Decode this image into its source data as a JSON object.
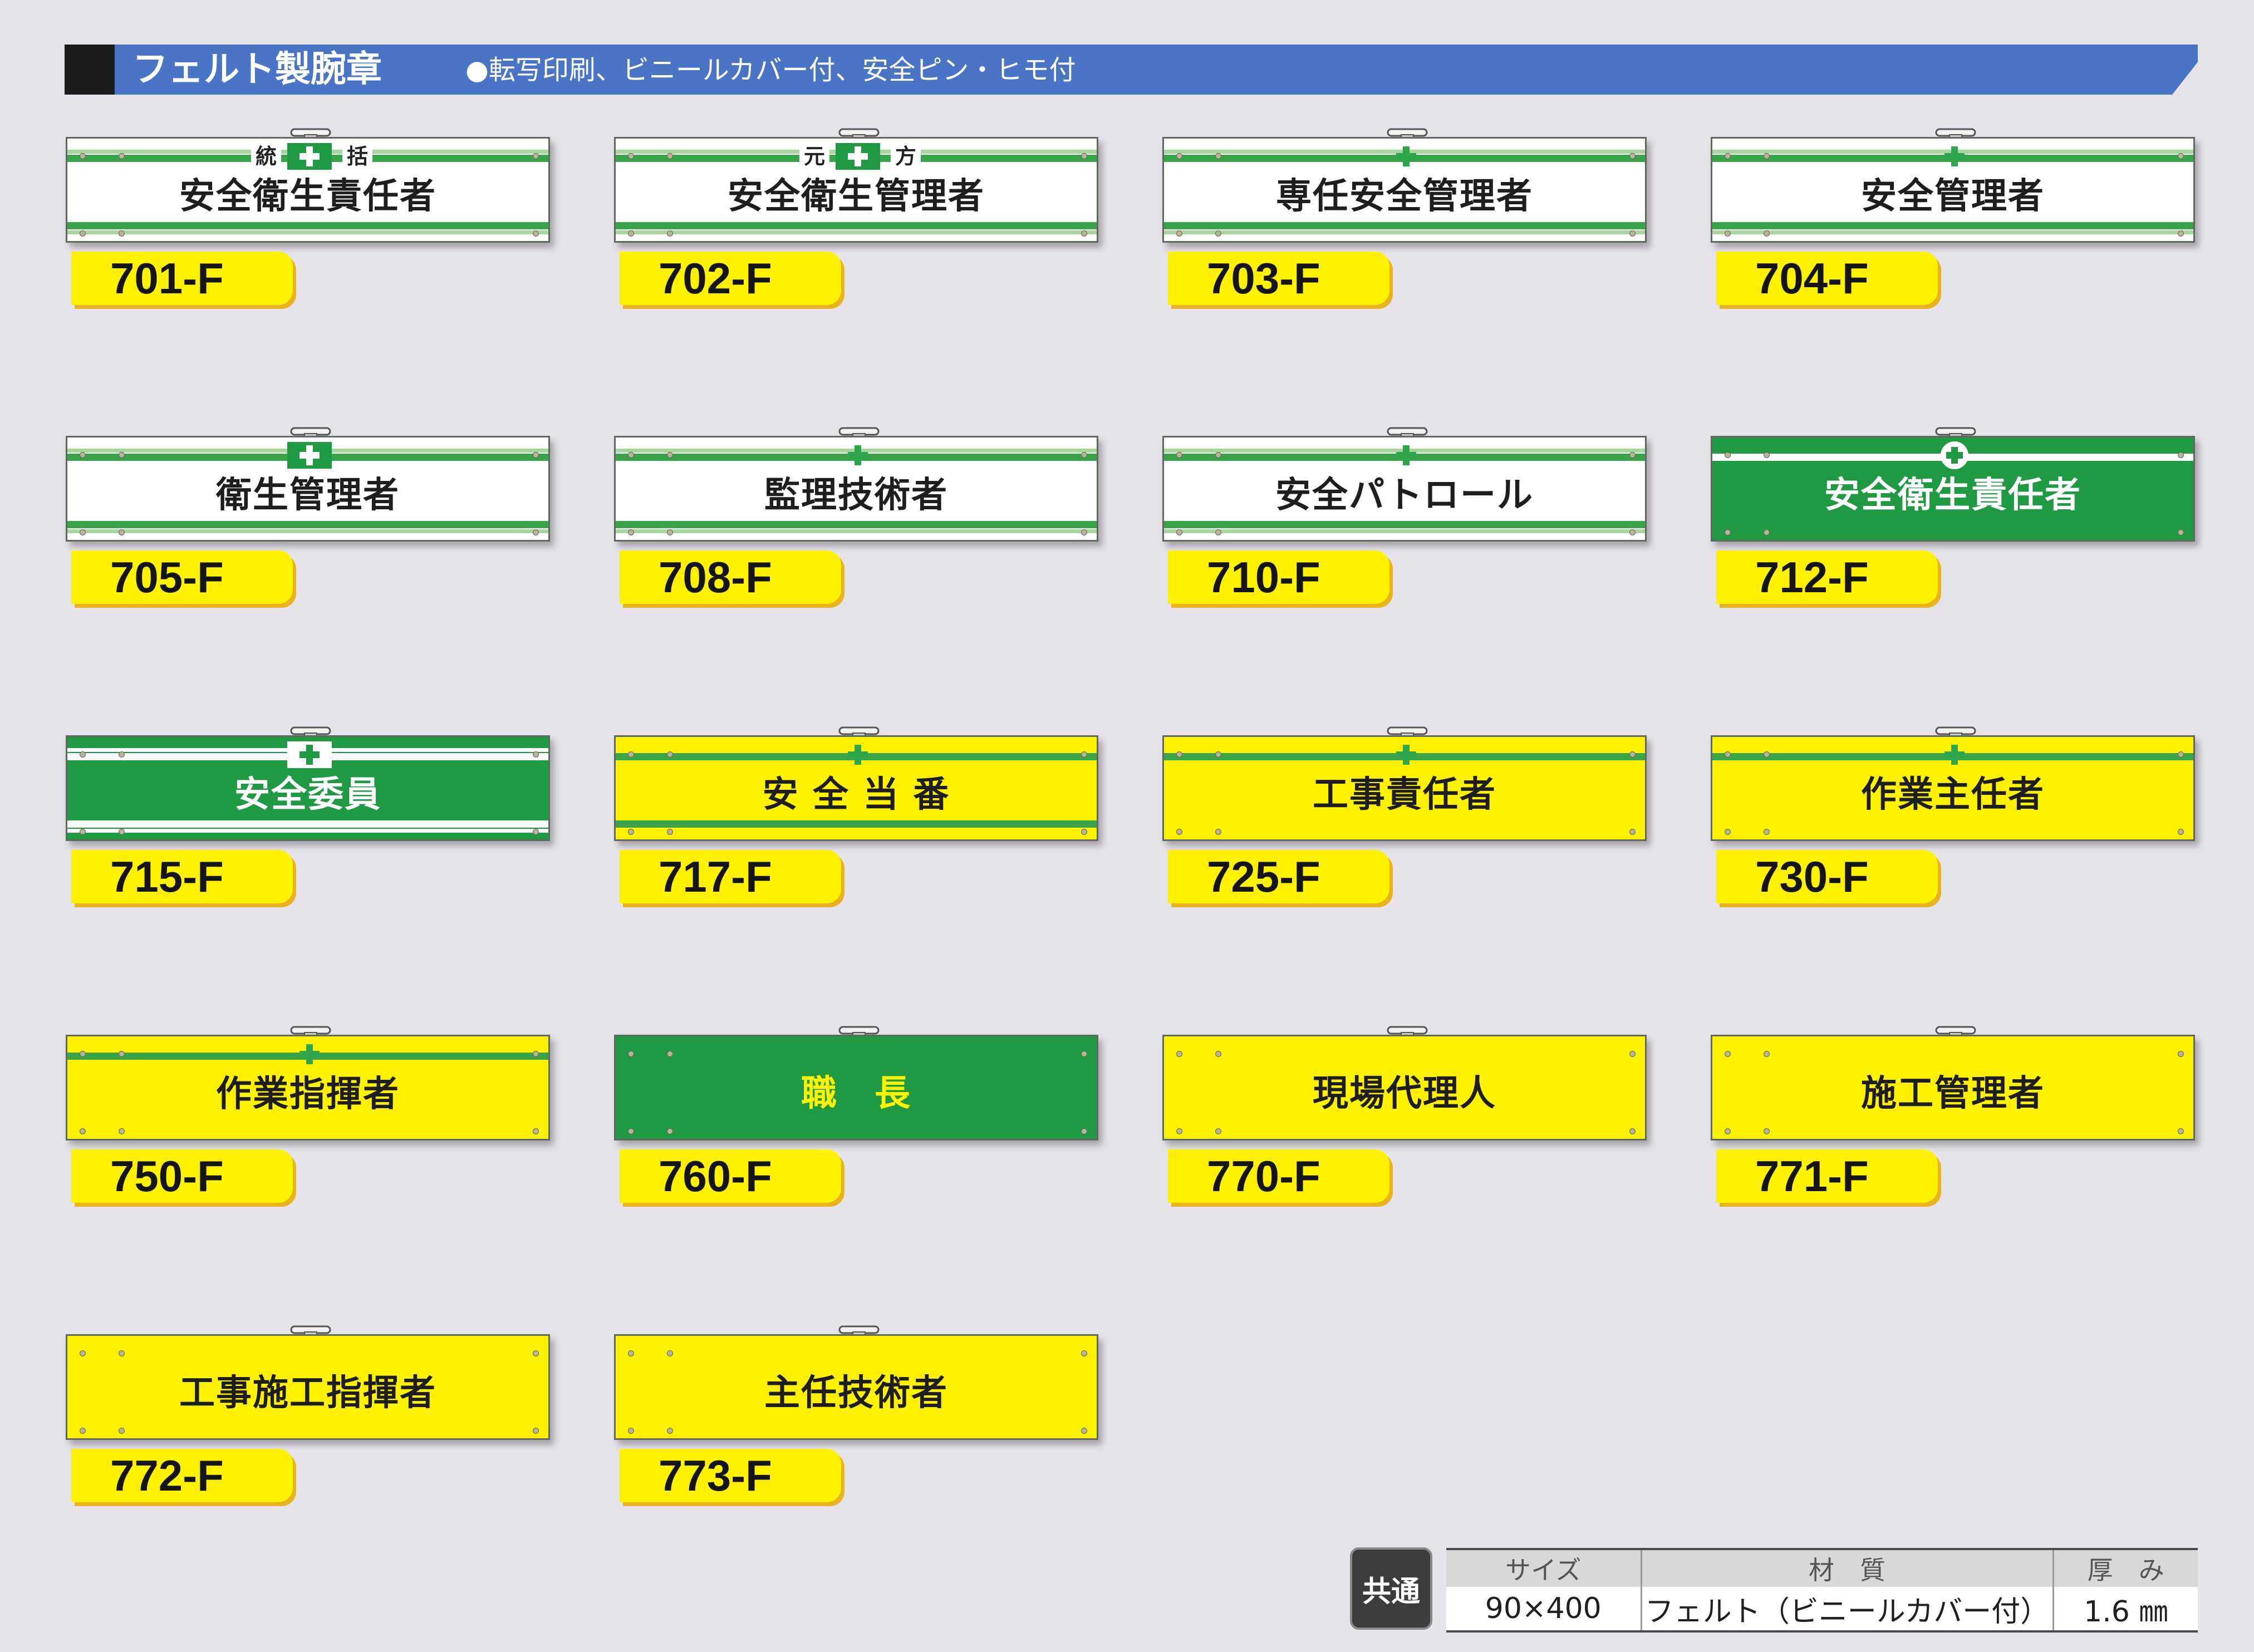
{
  "header": {
    "title": "フェルト製腕章",
    "subtitle": "●転写印刷、ビニールカバー付、安全ピン・ヒモ付"
  },
  "colors": {
    "header_blue": "#4a74c6",
    "band_green": "#1f9a43",
    "band_yellow": "#fff200",
    "tag_yellow": "#fff200",
    "stripe_green": "#3aa44a",
    "background": "#e6e3ea"
  },
  "products": [
    {
      "code": "701-F",
      "label": "安全衛生責任者",
      "band": "white",
      "badge": "box-cross",
      "left_label": "統",
      "right_label": "括"
    },
    {
      "code": "702-F",
      "label": "安全衛生管理者",
      "band": "white",
      "badge": "box-cross",
      "left_label": "元",
      "right_label": "方"
    },
    {
      "code": "703-F",
      "label": "専任安全管理者",
      "band": "white",
      "badge": "plain-cross"
    },
    {
      "code": "704-F",
      "label": "安全管理者",
      "band": "white",
      "badge": "plain-cross"
    },
    {
      "code": "705-F",
      "label": "衛生管理者",
      "band": "white",
      "badge": "box-cross"
    },
    {
      "code": "708-F",
      "label": "監理技術者",
      "band": "white",
      "badge": "plain-cross"
    },
    {
      "code": "710-F",
      "label": "安全パトロール",
      "band": "white",
      "badge": "plain-cross"
    },
    {
      "code": "712-F",
      "label": "安全衛生責任者",
      "band": "green",
      "badge": "circle-cross"
    },
    {
      "code": "715-F",
      "label": "安全委員",
      "band": "green",
      "badge": "white-box-cross"
    },
    {
      "code": "717-F",
      "label": "安 全 当 番",
      "band": "yellow",
      "badge": "plain-cross"
    },
    {
      "code": "725-F",
      "label": "工事責任者",
      "band": "yellow",
      "badge": "plain-cross"
    },
    {
      "code": "730-F",
      "label": "作業主任者",
      "band": "yellow",
      "badge": "plain-cross"
    },
    {
      "code": "750-F",
      "label": "作業指揮者",
      "band": "yellow",
      "badge": "plain-cross"
    },
    {
      "code": "760-F",
      "label": "職　長",
      "band": "green",
      "badge": "none"
    },
    {
      "code": "770-F",
      "label": "現場代理人",
      "band": "yellow",
      "badge": "none"
    },
    {
      "code": "771-F",
      "label": "施工管理者",
      "band": "yellow",
      "badge": "none"
    },
    {
      "code": "772-F",
      "label": "工事施工指揮者",
      "band": "yellow",
      "badge": "none"
    },
    {
      "code": "773-F",
      "label": "主任技術者",
      "band": "yellow",
      "badge": "none"
    }
  ],
  "specs": {
    "badge": "共通",
    "headers": [
      "サイズ",
      "材　質",
      "厚　み"
    ],
    "values": [
      "90×400",
      "フェルト（ビニールカバー付）",
      "1.6 ㎜"
    ]
  }
}
